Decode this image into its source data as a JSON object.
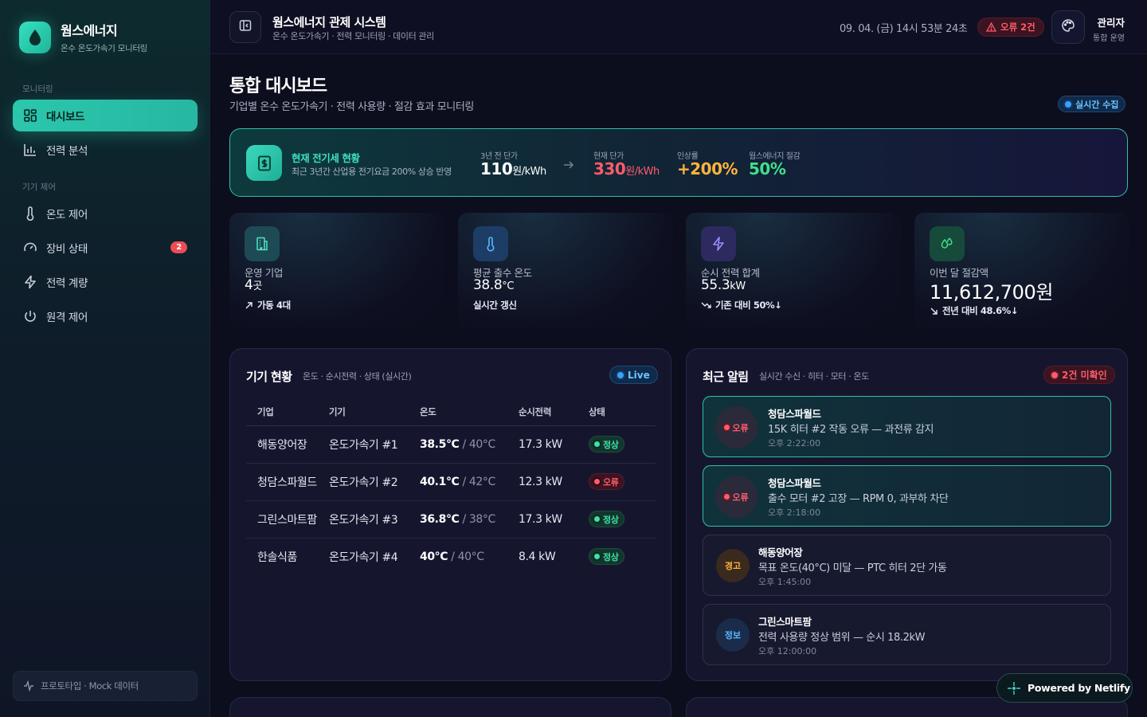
{
  "brand": {
    "name": "웜스에너지",
    "subtitle": "온수 온도가속기 모니터링"
  },
  "sidebar": {
    "sections": [
      "모니터링",
      "기기 제어"
    ],
    "items": [
      {
        "label": "대시보드",
        "icon": "grid-icon",
        "active": true
      },
      {
        "label": "전력 분석",
        "icon": "bar-chart-icon"
      },
      {
        "label": "온도 제어",
        "icon": "thermometer-icon"
      },
      {
        "label": "장비 상태",
        "icon": "gauge-icon",
        "badge": "2"
      },
      {
        "label": "전력 계량",
        "icon": "bolt-icon"
      },
      {
        "label": "원격 제어",
        "icon": "power-icon"
      }
    ],
    "footer": "프로토타입 · Mock 데이터"
  },
  "topbar": {
    "title": "웜스에너지 관제 시스템",
    "subtitle": "온수 온도가속기 · 전력 모니터링 · 데이터 관리",
    "datetime": "09. 04. (금) 14시 53분 24초",
    "error_pill": "오류 2건",
    "user_name": "관리자",
    "user_role": "통합 운영"
  },
  "page": {
    "title": "통합 대시보드",
    "subtitle": "기업별 온수 온도가속기 · 전력 사용량 · 절감 효과 모니터링",
    "live_tag": "실시간 수집"
  },
  "banner": {
    "heading": "현재 전기세 현황",
    "desc": "최근 3년간 산업용 전기요금 200% 상승 반영",
    "prev_label": "3년 전 단가",
    "prev_value": "110",
    "prev_unit": "원/kWh",
    "cur_label": "현재 단가",
    "cur_value": "330",
    "cur_unit": "원/kWh",
    "rate_label": "인상률",
    "rate_value": "+200%",
    "save_label": "웜스에너지 절감",
    "save_value": "50%",
    "colors": {
      "prev": "#ffffff",
      "cur": "#ff5b6b",
      "rate": "#ffb43a",
      "save": "#3fe08a"
    }
  },
  "stats": [
    {
      "label": "운영 기업",
      "value": "4",
      "unit": "곳",
      "foot": "가동 4대",
      "icon": "building-icon",
      "foot_icon": "arrow-up-right-icon"
    },
    {
      "label": "평균 출수 온도",
      "value": "38.8",
      "unit": "°C",
      "foot": "실시간 갱신",
      "icon": "thermometer-icon",
      "foot_icon": ""
    },
    {
      "label": "순시 전력 합계",
      "value": "55.3",
      "unit": "kW",
      "foot": "기존 대비 50%↓",
      "icon": "bolt-icon",
      "foot_icon": "trend-down-icon"
    },
    {
      "label": "이번 달 절감액",
      "value": "11,612,700",
      "unit": "원",
      "foot": "전년 대비 48.6%↓",
      "icon": "drops-icon",
      "foot_icon": "arrow-down-right-icon"
    }
  ],
  "devices": {
    "title": "기기 현황",
    "subtitle": "온도 · 순시전력 · 상태 (실시간)",
    "live": "Live",
    "columns": [
      "기업",
      "기기",
      "온도",
      "순시전력",
      "상태"
    ],
    "rows": [
      {
        "company": "해동양어장",
        "device": "온도가속기 #1",
        "temp": "38.5°C",
        "target": "/ 40°C",
        "power": "17.3 kW",
        "status": "정상",
        "state": "ok"
      },
      {
        "company": "청담스파월드",
        "device": "온도가속기 #2",
        "temp": "40.1°C",
        "target": "/ 42°C",
        "power": "12.3 kW",
        "status": "오류",
        "state": "err"
      },
      {
        "company": "그린스마트팜",
        "device": "온도가속기 #3",
        "temp": "36.8°C",
        "target": "/ 38°C",
        "power": "17.3 kW",
        "status": "정상",
        "state": "ok"
      },
      {
        "company": "한솔식품",
        "device": "온도가속기 #4",
        "temp": "40°C",
        "target": "/ 40°C",
        "power": "8.4 kW",
        "status": "정상",
        "state": "ok"
      }
    ]
  },
  "alerts": {
    "title": "최근 알림",
    "subtitle": "실시간 수신 · 히터 · 모터 · 온도",
    "unread": "2건 미확인",
    "items": [
      {
        "level": "오류",
        "company": "청담스파월드",
        "message": "15K 히터 #2 작동 오류 — 과전류 감지",
        "time": "오후 2:22:00",
        "kind": "err"
      },
      {
        "level": "오류",
        "company": "청담스파월드",
        "message": "출수 모터 #2 고장 — RPM 0, 과부하 차단",
        "time": "오후 2:18:00",
        "kind": "err"
      },
      {
        "level": "경고",
        "company": "해동양어장",
        "message": "목표 온도(40°C) 미달 — PTC 히터 2단 가동",
        "time": "오후 1:45:00",
        "kind": "warn"
      },
      {
        "level": "정보",
        "company": "그린스마트팜",
        "message": "전력 사용량 정상 범위 — 순시 18.2kW",
        "time": "오후 12:00:00",
        "kind": "info"
      }
    ]
  },
  "netlify": {
    "prefix": "Powered by ",
    "name": "Netlify"
  }
}
